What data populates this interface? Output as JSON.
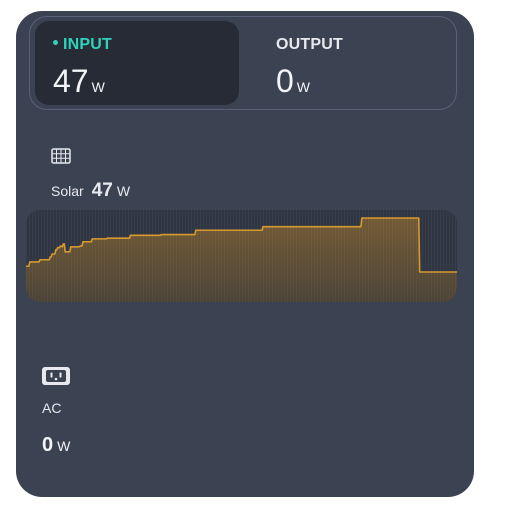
{
  "tabs": {
    "input": {
      "label": "INPUT",
      "value": "47",
      "unit": "W",
      "active": true
    },
    "output": {
      "label": "OUTPUT",
      "value": "0",
      "unit": "W",
      "active": false
    }
  },
  "solar": {
    "icon": "solar-panel-icon",
    "label": "Solar",
    "value": "47",
    "unit": "W",
    "trend": [
      33,
      33,
      33,
      33,
      39,
      39,
      39,
      39,
      39,
      39,
      39,
      39,
      39,
      39,
      39,
      42,
      42,
      42,
      42,
      42,
      42,
      42,
      42,
      42,
      42,
      42,
      46,
      46,
      50,
      50,
      50,
      50,
      56,
      56,
      59,
      59,
      59,
      61,
      61,
      60,
      64,
      64,
      53,
      53,
      53,
      53,
      53,
      53,
      60,
      60,
      60,
      60,
      60,
      60,
      60,
      60,
      60,
      60,
      61,
      61,
      61,
      67,
      67,
      67,
      67,
      67,
      67,
      67,
      67,
      67,
      67,
      71,
      71,
      71,
      71,
      71,
      71,
      71,
      71,
      71,
      71,
      71,
      71,
      71,
      71,
      71,
      71,
      72,
      72,
      72,
      72,
      72,
      72,
      72,
      72,
      72,
      72,
      72,
      72,
      72,
      72,
      72,
      72,
      72,
      72,
      72,
      72,
      72,
      72,
      72,
      72,
      72,
      76,
      76,
      76,
      76,
      76,
      76,
      76,
      76,
      76,
      76,
      76,
      76,
      76,
      76,
      76,
      76,
      76,
      76,
      76,
      76,
      76,
      76,
      76,
      76,
      76,
      76,
      76,
      76,
      76,
      76,
      76,
      76,
      76,
      77,
      77,
      77,
      77,
      77,
      77,
      77,
      77,
      77,
      77,
      77,
      77,
      77,
      77,
      77,
      77,
      77,
      77,
      77,
      77,
      77,
      77,
      77,
      77,
      77,
      77,
      77,
      77,
      77,
      77,
      77,
      77,
      77,
      77,
      77,
      77,
      77,
      83,
      83,
      83,
      83,
      83,
      83,
      83,
      83,
      83,
      83,
      83,
      83,
      83,
      83,
      83,
      83,
      83,
      83,
      83,
      83,
      83,
      83,
      83,
      83,
      83,
      83,
      83,
      83,
      83,
      83,
      83,
      83,
      83,
      83,
      83,
      83,
      83,
      83,
      83,
      83,
      83,
      83,
      83,
      83,
      83,
      83,
      83,
      83,
      83,
      83,
      83,
      83,
      83,
      83,
      83,
      83,
      83,
      83,
      83,
      83,
      83,
      83,
      83,
      83,
      83,
      83,
      83,
      83,
      83,
      83,
      83,
      83,
      88,
      88,
      88,
      88,
      88,
      88,
      88,
      88,
      88,
      88,
      88,
      88,
      88,
      88,
      88,
      88,
      88,
      88,
      88,
      88,
      88,
      88,
      88,
      88,
      88,
      88,
      88,
      88,
      88,
      88,
      88,
      88,
      88,
      88,
      88,
      88,
      88,
      88,
      88,
      88,
      88,
      88,
      88,
      88,
      88,
      88,
      88,
      88,
      88,
      88,
      88,
      88,
      88,
      88,
      88,
      88,
      88,
      88,
      88,
      88,
      88,
      88,
      88,
      88,
      88,
      88,
      88,
      88,
      88,
      88,
      88,
      88,
      88,
      88,
      88,
      88,
      88,
      88,
      88,
      88,
      88,
      88,
      88,
      88,
      88,
      88,
      88,
      88,
      88,
      88,
      88,
      88,
      88,
      88,
      88,
      88,
      88,
      88,
      88,
      88,
      88,
      88,
      88,
      88,
      88,
      88,
      100,
      100,
      100,
      100,
      100,
      100,
      100,
      100,
      100,
      100,
      100,
      100,
      100,
      100,
      100,
      100,
      100,
      100,
      100,
      100,
      100,
      100,
      100,
      100,
      100,
      100,
      100,
      100,
      100,
      100,
      100,
      100,
      100,
      100,
      100,
      100,
      100,
      100,
      100,
      100,
      100,
      100,
      100,
      100,
      100,
      100,
      100,
      100,
      100,
      100,
      100,
      100,
      100,
      100,
      100,
      100,
      100,
      100,
      100,
      100,
      100,
      100,
      25,
      25,
      25,
      25,
      25,
      25,
      25,
      25,
      25,
      25,
      25,
      25,
      25,
      25,
      25,
      25,
      25,
      25,
      25,
      25,
      25,
      25,
      25,
      25,
      25,
      25,
      25,
      25,
      25,
      25,
      25,
      25,
      25,
      25,
      25,
      25,
      25,
      25,
      25,
      25,
      25
    ]
  },
  "ac": {
    "icon": "ac-outlet-icon",
    "label": "AC",
    "value": "0",
    "unit": "W"
  },
  "colors": {
    "panel": "#3b4252",
    "active_tab": "#262b36",
    "accent": "#2fd3bd",
    "trend_line": "#d69a2f",
    "trend_fill": "#6a5434"
  }
}
